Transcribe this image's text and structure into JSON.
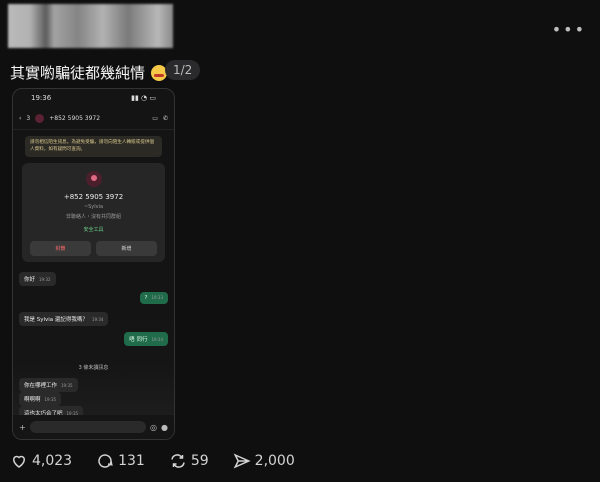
{
  "header": {
    "more": "•••"
  },
  "post": {
    "text": "其實喲騙徒都幾純情",
    "page_indicator": "1/2"
  },
  "screenshot": {
    "status_time": "19:36",
    "back_count": "3",
    "contact_number": "+852 5905 3972",
    "warning": "請勿相信陌生訊息。為避免受騙，請勿向陌生人轉賬或提供個人資料，如有疑問可查詢。",
    "card_number": "+852 5905 3972",
    "card_name": "~Sylvia",
    "card_sub": "非聯絡人・沒有共同群組",
    "safety_tools": "安全工具",
    "block_label": "封鎖",
    "add_label": "新增",
    "messages": [
      {
        "dir": "in",
        "text": "你好",
        "time": "19:32"
      },
      {
        "dir": "out",
        "text": "?",
        "time": "19:33"
      },
      {
        "dir": "in",
        "text": "我是 Sylvia 還記得我嗎？",
        "time": "19:34"
      },
      {
        "dir": "out",
        "text": "唔 同行",
        "time": "19:34"
      },
      {
        "dir": "in",
        "text": "你在哪裡工作",
        "time": "19:35"
      },
      {
        "dir": "in",
        "text": "啊啊啊",
        "time": "19:35"
      },
      {
        "dir": "in",
        "text": "這也太巧合了吧",
        "time": "19:35"
      }
    ],
    "unread_label": "3 條未讀訊息"
  },
  "actions": {
    "likes": "4,023",
    "comments": "131",
    "reposts": "59",
    "shares": "2,000"
  }
}
